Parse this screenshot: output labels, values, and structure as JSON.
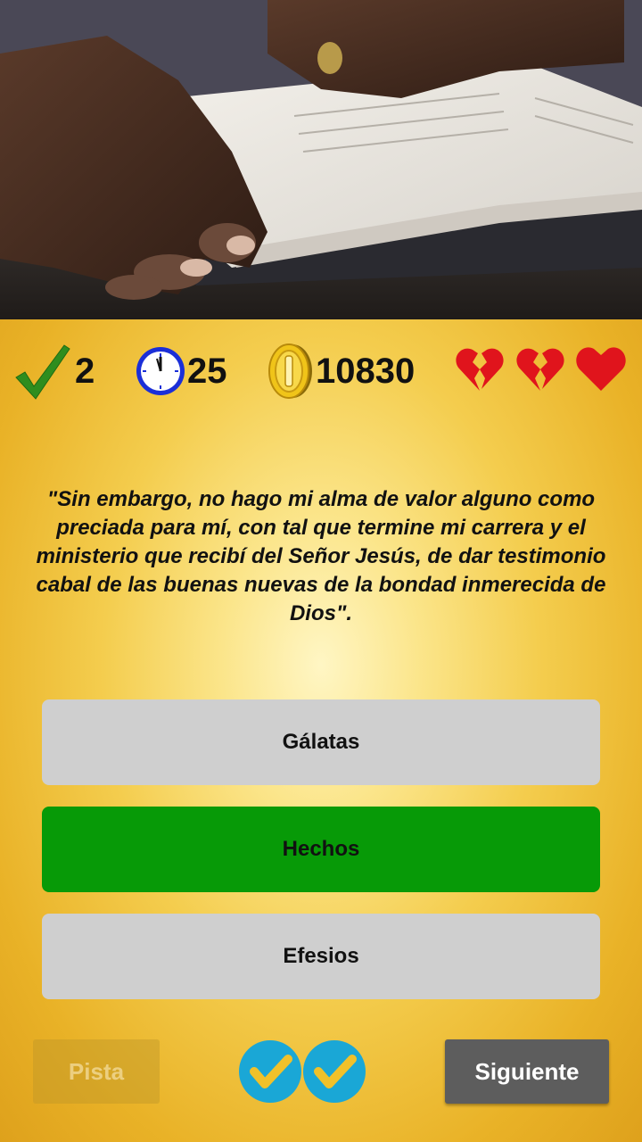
{
  "stats": {
    "correct_count": "2",
    "time_left": "25",
    "coins": "10830",
    "lives": [
      "broken",
      "broken",
      "full"
    ]
  },
  "question": {
    "text": "\"Sin embargo, no hago mi alma de valor alguno como preciada para mí, con tal que termine mi carrera y el ministerio que recibí del Señor Jesús, de dar testimonio cabal de las buenas nuevas de la bondad inmerecida de Dios\"."
  },
  "answers": [
    {
      "label": "Gálatas",
      "state": "default"
    },
    {
      "label": "Hechos",
      "state": "correct"
    },
    {
      "label": "Efesios",
      "state": "default"
    }
  ],
  "controls": {
    "hint_label": "Pista",
    "next_label": "Siguiente"
  },
  "colors": {
    "correct_green": "#079a07",
    "answer_gray": "#cfcfcf",
    "heart_red": "#e0141c",
    "badge_blue": "#1aa7d6",
    "badge_check": "#f0c12a"
  },
  "icons": {
    "correct": "checkmark-icon",
    "timer": "clock-icon",
    "coins": "coin-icon",
    "lives": "heart-icon",
    "powerups": "check-badge-icon"
  }
}
